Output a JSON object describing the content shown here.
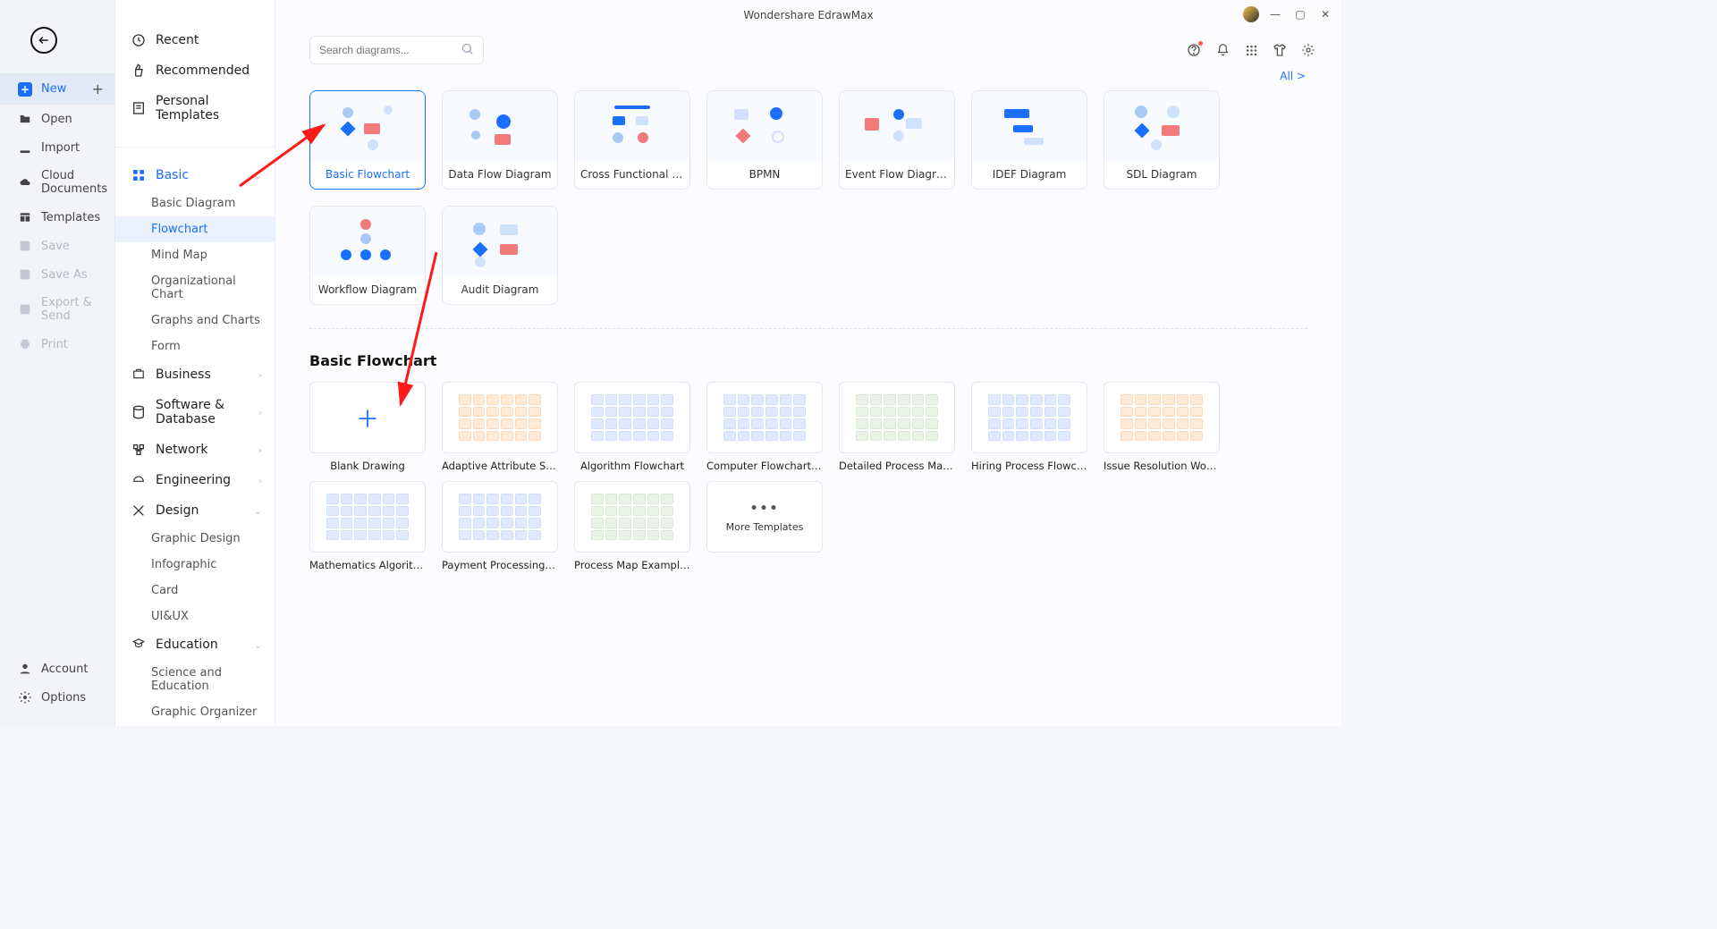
{
  "app": {
    "title": "Wondershare EdrawMax"
  },
  "rail": {
    "items": [
      {
        "id": "new",
        "label": "New",
        "active": true,
        "plus_right": true
      },
      {
        "id": "open",
        "label": "Open"
      },
      {
        "id": "import",
        "label": "Import"
      },
      {
        "id": "cloud",
        "label": "Cloud Documents"
      },
      {
        "id": "templates",
        "label": "Templates"
      },
      {
        "id": "save",
        "label": "Save",
        "disabled": true
      },
      {
        "id": "saveas",
        "label": "Save As",
        "disabled": true
      },
      {
        "id": "export",
        "label": "Export & Send",
        "disabled": true
      },
      {
        "id": "print",
        "label": "Print",
        "disabled": true
      }
    ],
    "bottom": [
      {
        "id": "account",
        "label": "Account"
      },
      {
        "id": "options",
        "label": "Options"
      }
    ]
  },
  "nav": {
    "top": [
      {
        "id": "recent",
        "label": "Recent"
      },
      {
        "id": "recommended",
        "label": "Recommended"
      },
      {
        "id": "personal",
        "label": "Personal Templates"
      }
    ],
    "categories": [
      {
        "id": "basic",
        "label": "Basic",
        "selected": true,
        "expanded": true,
        "children": [
          {
            "id": "basic-diagram",
            "label": "Basic Diagram"
          },
          {
            "id": "flowchart",
            "label": "Flowchart",
            "selected": true
          },
          {
            "id": "mind-map",
            "label": "Mind Map"
          },
          {
            "id": "org-chart",
            "label": "Organizational Chart"
          },
          {
            "id": "graphs",
            "label": "Graphs and Charts"
          },
          {
            "id": "form",
            "label": "Form"
          }
        ]
      },
      {
        "id": "business",
        "label": "Business"
      },
      {
        "id": "software",
        "label": "Software & Database"
      },
      {
        "id": "network",
        "label": "Network"
      },
      {
        "id": "engineering",
        "label": "Engineering"
      },
      {
        "id": "design",
        "label": "Design",
        "expanded": true,
        "children": [
          {
            "id": "graphic-design",
            "label": "Graphic Design"
          },
          {
            "id": "infographic",
            "label": "Infographic"
          },
          {
            "id": "card",
            "label": "Card"
          },
          {
            "id": "uiux",
            "label": "UI&UX"
          }
        ]
      },
      {
        "id": "education",
        "label": "Education",
        "expanded": true,
        "children": [
          {
            "id": "science-edu",
            "label": "Science and Education"
          },
          {
            "id": "graphic-organizer",
            "label": "Graphic Organizer"
          }
        ]
      }
    ]
  },
  "search": {
    "placeholder": "Search diagrams..."
  },
  "all_link": "All   >",
  "types": [
    {
      "id": "basic-flowchart",
      "label": "Basic Flowchart",
      "selected": true
    },
    {
      "id": "data-flow",
      "label": "Data Flow Diagram"
    },
    {
      "id": "cross-functional",
      "label": "Cross Functional Flow..."
    },
    {
      "id": "bpmn",
      "label": "BPMN"
    },
    {
      "id": "event-flow",
      "label": "Event Flow Diagram"
    },
    {
      "id": "idef",
      "label": "IDEF Diagram"
    },
    {
      "id": "sdl",
      "label": "SDL Diagram"
    },
    {
      "id": "workflow",
      "label": "Workflow Diagram"
    },
    {
      "id": "audit",
      "label": "Audit Diagram"
    }
  ],
  "section_title": "Basic Flowchart",
  "templates_row1": [
    {
      "id": "blank",
      "label": "Blank Drawing",
      "blank": true
    },
    {
      "id": "adaptive",
      "label": "Adaptive Attribute Selectio..."
    },
    {
      "id": "algorithm",
      "label": "Algorithm Flowchart"
    },
    {
      "id": "computer",
      "label": "Computer Flowchart Temp..."
    },
    {
      "id": "detailed",
      "label": "Detailed Process Map Tem..."
    },
    {
      "id": "hiring",
      "label": "Hiring Process Flowchart"
    },
    {
      "id": "issue",
      "label": "Issue Resolution Workflow ..."
    }
  ],
  "templates_row2": [
    {
      "id": "math",
      "label": "Mathematics Algorithm Fl..."
    },
    {
      "id": "payment",
      "label": "Payment Processing Workf..."
    },
    {
      "id": "process",
      "label": "Process Map Examples Te..."
    },
    {
      "id": "more",
      "label": "More Templates",
      "more": true
    }
  ]
}
